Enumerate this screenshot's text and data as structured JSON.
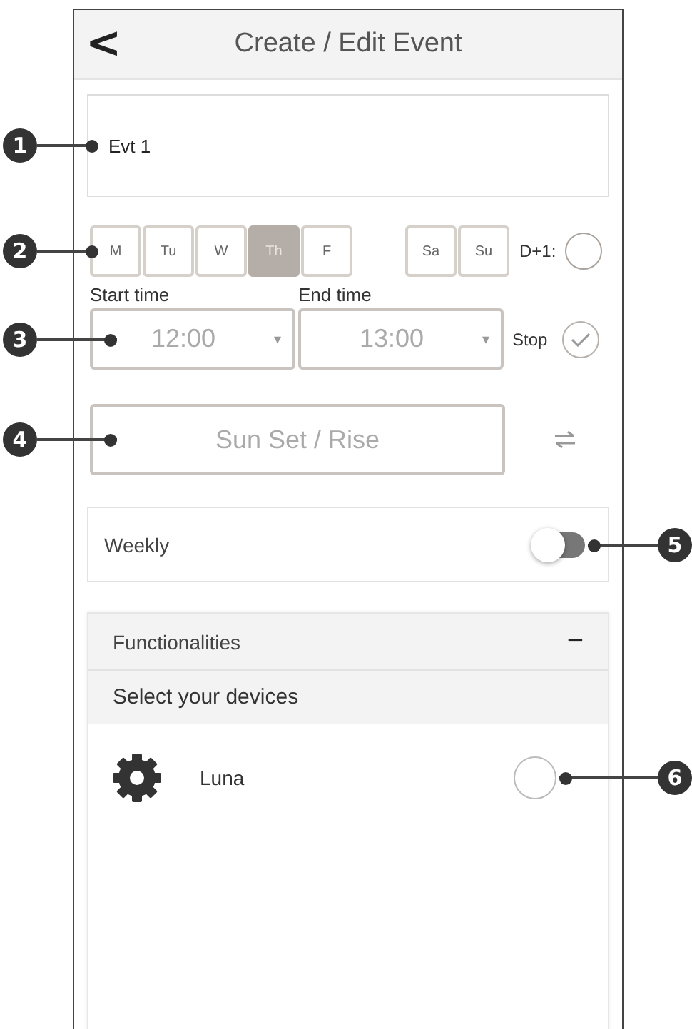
{
  "header": {
    "back": "<",
    "title": "Create / Edit Event"
  },
  "name_field": {
    "value": "Evt 1",
    "callout": "1"
  },
  "days": {
    "callout": "2",
    "weekdays": [
      {
        "label": "M",
        "selected": false
      },
      {
        "label": "Tu",
        "selected": false
      },
      {
        "label": "W",
        "selected": false
      },
      {
        "label": "Th",
        "selected": true
      },
      {
        "label": "F",
        "selected": false
      }
    ],
    "weekend": [
      {
        "label": "Sa",
        "selected": false
      },
      {
        "label": "Su",
        "selected": false
      }
    ],
    "next_day": {
      "label": "D+1:",
      "checked": false
    }
  },
  "times": {
    "callout": "3",
    "start": {
      "label": "Start time",
      "value": "12:00",
      "arrow": "▾"
    },
    "end": {
      "label": "End time",
      "value": "13:00",
      "arrow": "▾"
    },
    "stop": {
      "label": "Stop",
      "checked": true
    }
  },
  "sun_button": {
    "label": "Sun Set / Rise",
    "callout": "4"
  },
  "weekly": {
    "label": "Weekly",
    "on": false,
    "callout": "5"
  },
  "functionalities": {
    "title": "Functionalities",
    "toggle": "−",
    "expanded": true,
    "subtitle": "Select your devices",
    "devices": [
      {
        "name": "Luna",
        "selected": false,
        "callout": "6"
      }
    ]
  }
}
